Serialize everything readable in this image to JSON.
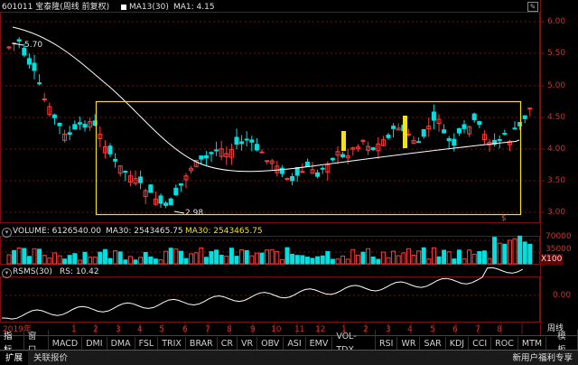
{
  "header": {
    "code_name": "601011 宝泰隆(周线 前复权)",
    "ma13": "MA13(30)",
    "ma1": "MA1: 4.15"
  },
  "price_axis": [
    "6.00",
    "5.50",
    "5.00",
    "4.50",
    "4.00",
    "3.50",
    "3.00"
  ],
  "annotations": {
    "high": "5.70",
    "low": "2.98",
    "marker": "$"
  },
  "volume": {
    "label": "VOLUME: 6126540.00",
    "ma30": "MA30: 2543465.75",
    "ma30b": "MA30: 2543465.75",
    "axis": [
      "70000",
      "35000"
    ],
    "unit": "X100"
  },
  "rsms": {
    "label": "RSMS(30)",
    "value": "RS: 10.42",
    "axis": "0.00"
  },
  "time_axis": {
    "year": "2019年",
    "months": [
      "1",
      "2",
      "3",
      "4",
      "5",
      "6",
      "7",
      "8",
      "9",
      "10",
      "11",
      "12",
      "1",
      "2",
      "3",
      "4",
      "5",
      "6",
      "7",
      "8"
    ],
    "period": "周线"
  },
  "indicator_tabs": [
    "指标",
    "窗口",
    "MACD",
    "DMI",
    "DMA",
    "FSL",
    "TRIX",
    "BRAR",
    "CR",
    "VR",
    "OBV",
    "ASI",
    "EMV",
    "VOL-TDX",
    "RSI",
    "WR",
    "SAR",
    "KDJ",
    "CCI",
    "ROC",
    "MTM",
    "模板"
  ],
  "bottom_tabs": [
    "扩展",
    "关联报价"
  ],
  "bottom_right": "新用户福利专享",
  "colors": {
    "up": "#ff3c3c",
    "down": "#00e0e0",
    "ma": "#ffffff",
    "box": "#f0e020",
    "grid": "#7a1010"
  }
}
